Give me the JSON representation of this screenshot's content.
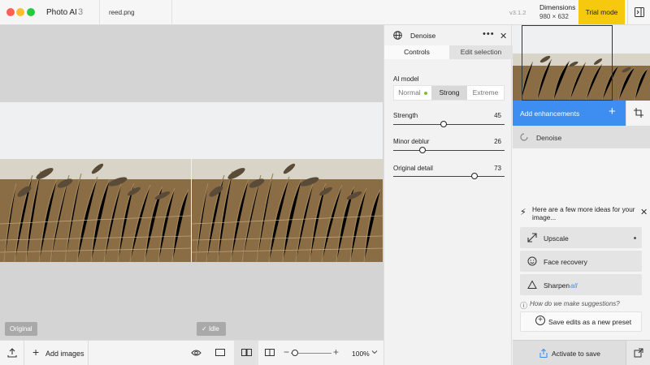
{
  "titlebar": {
    "app_name": "Photo AI",
    "app_version": "3",
    "file_name": "reed.png",
    "version": "v3.1.2",
    "dimensions_label": "Dimensions",
    "dimensions_value": "980 × 632",
    "trial_label": "Trial mode"
  },
  "canvas": {
    "left_tag": "Original",
    "right_tag": "Idle"
  },
  "bottombar": {
    "add_images_label": "Add images",
    "zoom_value": "100%",
    "zoom_minus": "−",
    "zoom_plus": "+",
    "add_plus": "+"
  },
  "denoise_panel": {
    "title": "Denoise",
    "more": "•••",
    "close": "✕",
    "tabs": [
      "Controls",
      "Edit selection"
    ],
    "ai_model_label": "AI model",
    "models": [
      "Normal",
      "Strong",
      "Extreme"
    ],
    "selected_model": "Strong",
    "sliders": [
      {
        "label": "Strength",
        "value": 45
      },
      {
        "label": "Minor deblur",
        "value": 26
      },
      {
        "label": "Original detail",
        "value": 73
      }
    ]
  },
  "right_panel": {
    "add_enhancements_label": "Add enhancements",
    "add_plus": "+",
    "denoise_item": "Denoise",
    "ideas_text": "Here are a few more ideas for your image...",
    "ideas_close": "✕",
    "suggestions": [
      {
        "label": "Upscale"
      },
      {
        "label": "Face recovery"
      },
      {
        "label": "Sharpen",
        "extra": "all"
      }
    ],
    "how_text": "How do we make suggestions?",
    "info_glyph": "ⓘ",
    "save_preset_label": "Save edits as a new preset",
    "save_plus": "+",
    "activate_label": "Activate to save"
  },
  "colors": {
    "accent_blue": "#3d8ef0",
    "trial_yellow": "#f6c90e"
  }
}
